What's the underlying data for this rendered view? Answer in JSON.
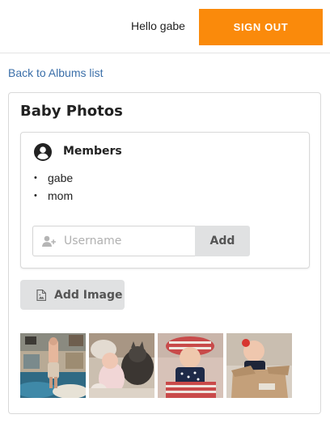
{
  "header": {
    "greeting": "Hello gabe",
    "sign_out_label": "SIGN OUT",
    "accent_color": "#fa8a0b"
  },
  "nav": {
    "back_link": "Back to Albums list"
  },
  "album": {
    "title": "Baby Photos",
    "members": {
      "icon": "user-circle-icon",
      "title": "Members",
      "list": [
        "gabe",
        "mom"
      ],
      "add_form": {
        "icon": "add-user-icon",
        "placeholder": "Username",
        "value": "",
        "button_label": "Add"
      }
    },
    "add_image": {
      "icon": "file-image-icon",
      "label": "Add Image"
    },
    "photos": [
      {
        "subject": "baby held up by hands",
        "bg": "#5a6c74"
      },
      {
        "subject": "baby with cat on bed",
        "bg": "#b9a796"
      },
      {
        "subject": "baby in striped hat",
        "bg": "#d9b6ad"
      },
      {
        "subject": "baby in cardboard box",
        "bg": "#cfb69b"
      }
    ]
  }
}
